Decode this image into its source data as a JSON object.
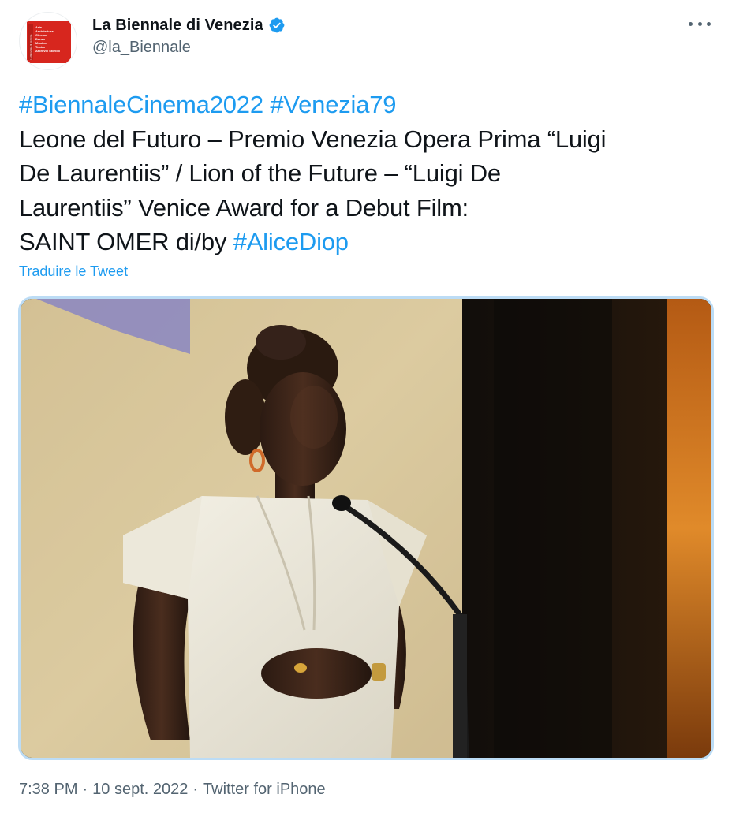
{
  "author": {
    "display_name": "La Biennale di Venezia",
    "handle": "@la_Biennale",
    "verified": true,
    "avatar_icon": "biennale-logo",
    "avatar_lines": [
      "Arte",
      "Architettura",
      "Cinema",
      "Danza",
      "Musica",
      "Teatro",
      "Archivio Storico"
    ],
    "avatar_vertical": "La Biennale di Venezia",
    "avatar_color": "#d7261e"
  },
  "tweet": {
    "hashtag_line": [
      "#BiennaleCinema2022",
      "#Venezia79"
    ],
    "line2": "Leone del Futuro – Premio Venezia Opera Prima “Luigi",
    "line3": "De Laurentiis” / Lion of the Future – “Luigi De",
    "line4": "Laurentiis” Venice Award for a Debut Film:",
    "line5_prefix": "SAINT OMER di/by ",
    "line5_hashtag": "#AliceDiop",
    "translate_label": "Traduire le Tweet"
  },
  "media": {
    "description_icon": "photo"
  },
  "meta": {
    "time": "7:38 PM",
    "date": "10 sept. 2022",
    "source": "Twitter for iPhone",
    "separator": "·"
  },
  "colors": {
    "link": "#1d9bf0",
    "secondary": "#536471",
    "verified": "#1d9bf0"
  },
  "icons": {
    "more": "more-horizontal-icon",
    "verified": "verified-badge-icon"
  }
}
